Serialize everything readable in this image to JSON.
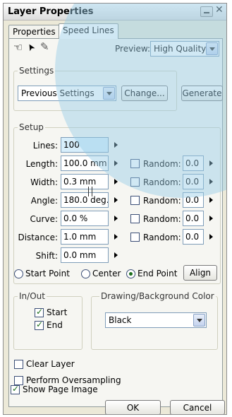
{
  "window": {
    "title": "Layer Properties",
    "close_glyph": "✕"
  },
  "tabs": [
    {
      "label": "Properties"
    },
    {
      "label": "Speed Lines"
    }
  ],
  "toolbar": {
    "hand_glyph": "☜",
    "arrow_glyph": "➤",
    "pen_glyph": "✎",
    "preview_label": "Preview:",
    "preview_value": "High Quality"
  },
  "settings": {
    "legend": "Settings",
    "preset_value": "Previous Settings",
    "change_label": "Change...",
    "generate_label": "Generate"
  },
  "setup": {
    "legend": "Setup",
    "lines_label": "Lines:",
    "lines_value": "100",
    "length_label": "Length:",
    "length_value": "100.0 mm",
    "width_label": "Width:",
    "width_value": "0.3 mm",
    "angle_label": "Angle:",
    "angle_value": "180.0 deg.",
    "curve_label": "Curve:",
    "curve_value": "0.0 %",
    "distance_label": "Distance:",
    "distance_value": "1.0 mm",
    "shift_label": "Shift:",
    "shift_value": "0.0 mm",
    "random_label": "Random:",
    "random_values": [
      "0.0",
      "0.0",
      "0.0",
      "0.0",
      "0.0"
    ]
  },
  "anchor": {
    "start_label": "Start Point",
    "center_label": "Center",
    "end_label": "End Point",
    "selected": "End Point",
    "align_label": "Align"
  },
  "inout": {
    "legend": "In/Out",
    "start_label": "Start",
    "end_label": "End"
  },
  "color": {
    "legend": "Drawing/Background Color",
    "value": "Black"
  },
  "options": {
    "clear_layer_label": "Clear Layer",
    "oversampling_label": "Perform Oversampling",
    "show_page_label": "Show Page Image"
  },
  "buttons": {
    "ok_label": "OK",
    "cancel_label": "Cancel"
  }
}
